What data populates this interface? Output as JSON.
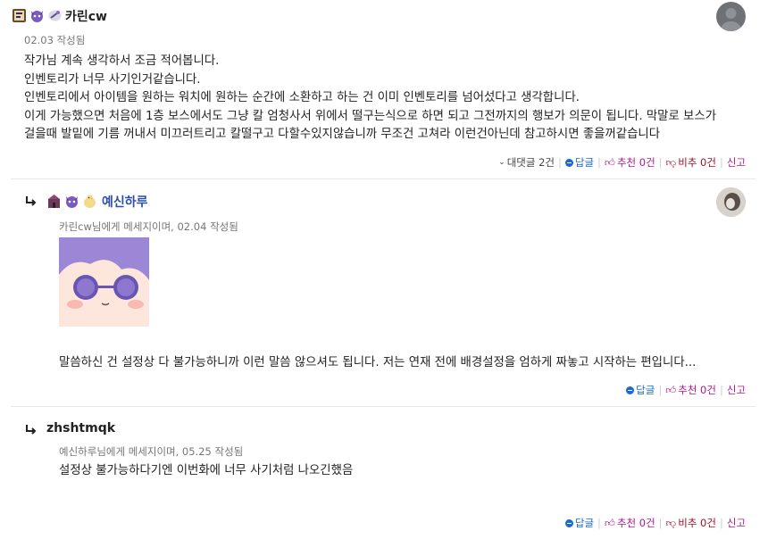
{
  "comments": [
    {
      "nickname": "카린cw",
      "date": "02.03 작성됨",
      "lines": [
        "작가님 계속 생각하서 조금 적어봅니다.",
        "인벤토리가 너무 사기인거같습니다.",
        "인벤토리에서 아이템을 원하는 워치에 원하는 순간에 소환하고 하는 건 이미 인벤토리를 넘어섰다고 생각합니다.",
        "이게 가능했으면 처음에 1층 보스에서도 그냥 칼 엄청사서 위에서 떨구는식으로 하면 되고 그전까지의 행보가 의문이 됩니다. 막말로 보스가",
        "걸을때 발밑에 기름 꺼내서 미끄러트리고 칼떨구고 다할수있지않습니까 무조건 고쳐라 이런건아닌데 참고하시면 좋을꺼같습니다"
      ],
      "replies_toggle": "대댓글 2건",
      "reply_label": "답글",
      "recommend_label": "추천 0건",
      "unrecommend_label": "비추 0건",
      "report_label": "신고"
    }
  ],
  "replies": [
    {
      "nickname": "예신하루",
      "meta": "카린cw님에게 메세지이며, 02.04 작성됨",
      "sticker": "chibi-sticker",
      "text": "말씀하신 건 설정상 다 불가능하니까 이런 말씀 않으셔도 됩니다. 저는 연재 전에 배경설정을 엄하게 짜놓고 시작하는 편입니다...",
      "reply_label": "답글",
      "recommend_label": "추천 0건",
      "report_label": "신고"
    },
    {
      "nickname": "zhshtmqk",
      "meta": "예신하루님에게 메세지이며, 05.25 작성됨",
      "text": "설정상 불가능하다기엔 이번화에 너무 사기처럼 나오긴했음",
      "reply_label": "답글",
      "recommend_label": "추천 0건",
      "unrecommend_label": "비추 0건",
      "report_label": "신고"
    }
  ],
  "colors": {
    "reply_blue": "#1a6bd1",
    "recommend_purple": "#b0198c",
    "unrecommend_red": "#a3102a",
    "nick_blue": "#2d4fa8"
  },
  "icons": [
    "badge-book-icon",
    "badge-demon-icon",
    "badge-scroll-icon",
    "reply-arrow-icon",
    "chevron-down-icon",
    "thumbs-up-icon",
    "thumbs-down-icon"
  ]
}
